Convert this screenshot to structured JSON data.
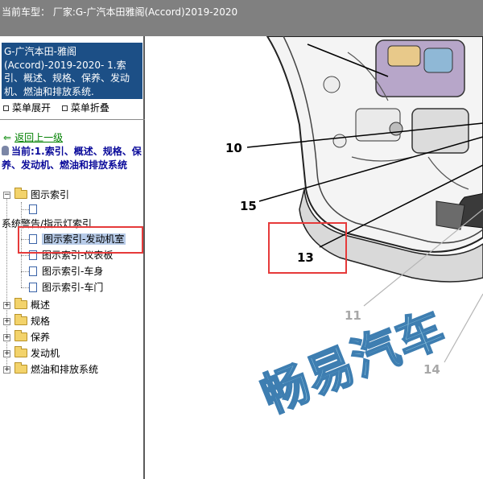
{
  "topbar": {
    "title": "当前车型：  厂家:G-广汽本田雅阁(Accord)2019-2020"
  },
  "left": {
    "header": "G-广汽本田-雅阁(Accord)-2019-2020- 1.索引、概述、规格、保养、发动机、燃油和排放系统.",
    "menu": {
      "expand": "菜单展开",
      "collapse": "菜单折叠"
    },
    "back_link": "返回上一级",
    "current": "当前:1.索引、概述、规格、保养、发动机、燃油和排放系统",
    "tree": {
      "diagram_index": "图示索引",
      "system_warning": "系统警告/指示灯索引",
      "children": [
        "图示索引-发动机室",
        "图示索引-仪表板",
        "图示索引-车身",
        "图示索引-车门"
      ],
      "folders": [
        "概述",
        "规格",
        "保养",
        "发动机",
        "燃油和排放系统"
      ]
    }
  },
  "diagram": {
    "callouts": [
      "10",
      "15",
      "13",
      "11",
      "14"
    ],
    "watermark": "畅易汽车"
  },
  "colors": {
    "header_blue": "#1c4f86",
    "highlight_red": "#e63a3a",
    "link_green": "#008000",
    "current_blue": "#0a0a9a"
  }
}
